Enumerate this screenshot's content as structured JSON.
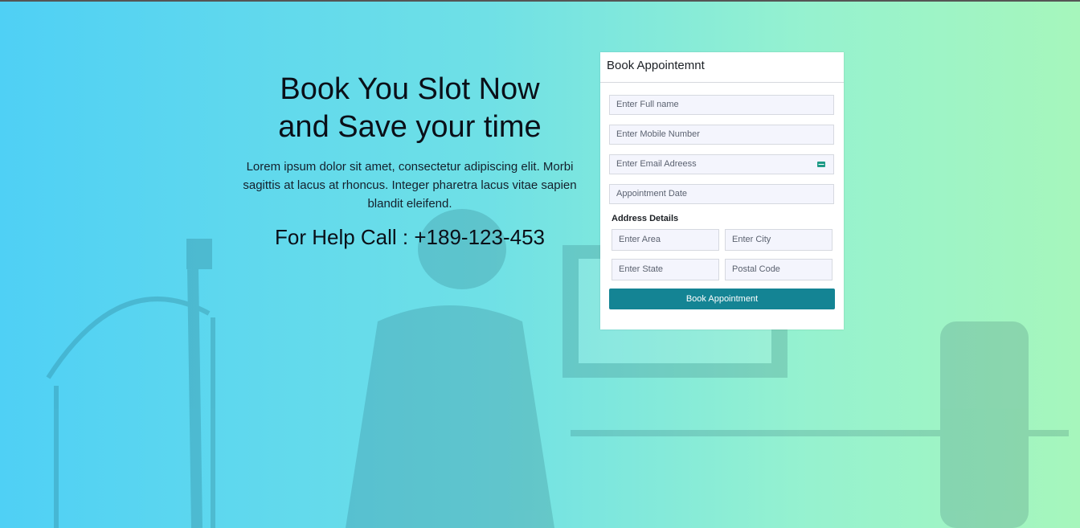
{
  "hero": {
    "title_line1": "Book You Slot Now",
    "title_line2": "and Save your time",
    "description": "Lorem ipsum dolor sit amet, consectetur adipiscing elit. Morbi sagittis at lacus at rhoncus. Integer pharetra lacus vitae sapien blandit eleifend.",
    "help_text": "For Help Call : +189-123-453"
  },
  "form": {
    "title": "Book Appointemnt",
    "full_name_placeholder": "Enter Full name",
    "mobile_placeholder": "Enter Mobile Number",
    "email_placeholder": "Enter Email Adreess",
    "date_placeholder": "Appointment Date",
    "address_label": "Address Details",
    "area_placeholder": "Enter Area",
    "city_placeholder": "Enter City",
    "state_placeholder": "Enter State",
    "postal_placeholder": "Postal Code",
    "submit_label": "Book Appointment",
    "email_icon": "envelope-icon"
  },
  "colors": {
    "gradient_left": "#4fd0f5",
    "gradient_right": "#a6f6bc",
    "button": "#148494"
  }
}
